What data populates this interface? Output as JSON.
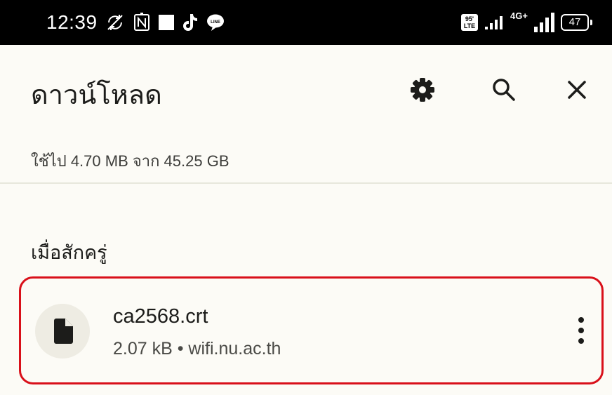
{
  "status_bar": {
    "time": "12:39",
    "network_badge_top": "95'",
    "network_badge_bottom": "LTE",
    "network_type": "4G+",
    "battery": "47",
    "icons": [
      "no-sync-icon",
      "nfc-icon",
      "square-notification-icon",
      "tiktok-icon",
      "line-chat-icon",
      "volte-badge-icon",
      "signal-icon",
      "signal-4g-icon",
      "battery-icon"
    ]
  },
  "app_bar": {
    "title": "ดาวน์โหลด",
    "actions": [
      "gear-icon",
      "search-icon",
      "close-icon"
    ]
  },
  "storage": {
    "text": "ใช้ไป 4.70 MB จาก 45.25 GB"
  },
  "section": {
    "heading": "เมื่อสักครู่"
  },
  "downloads": [
    {
      "name": "ca2568.crt",
      "meta": "2.07 kB • wifi.nu.ac.th",
      "icon": "file-icon",
      "highlight_color": "#d9101a"
    }
  ]
}
